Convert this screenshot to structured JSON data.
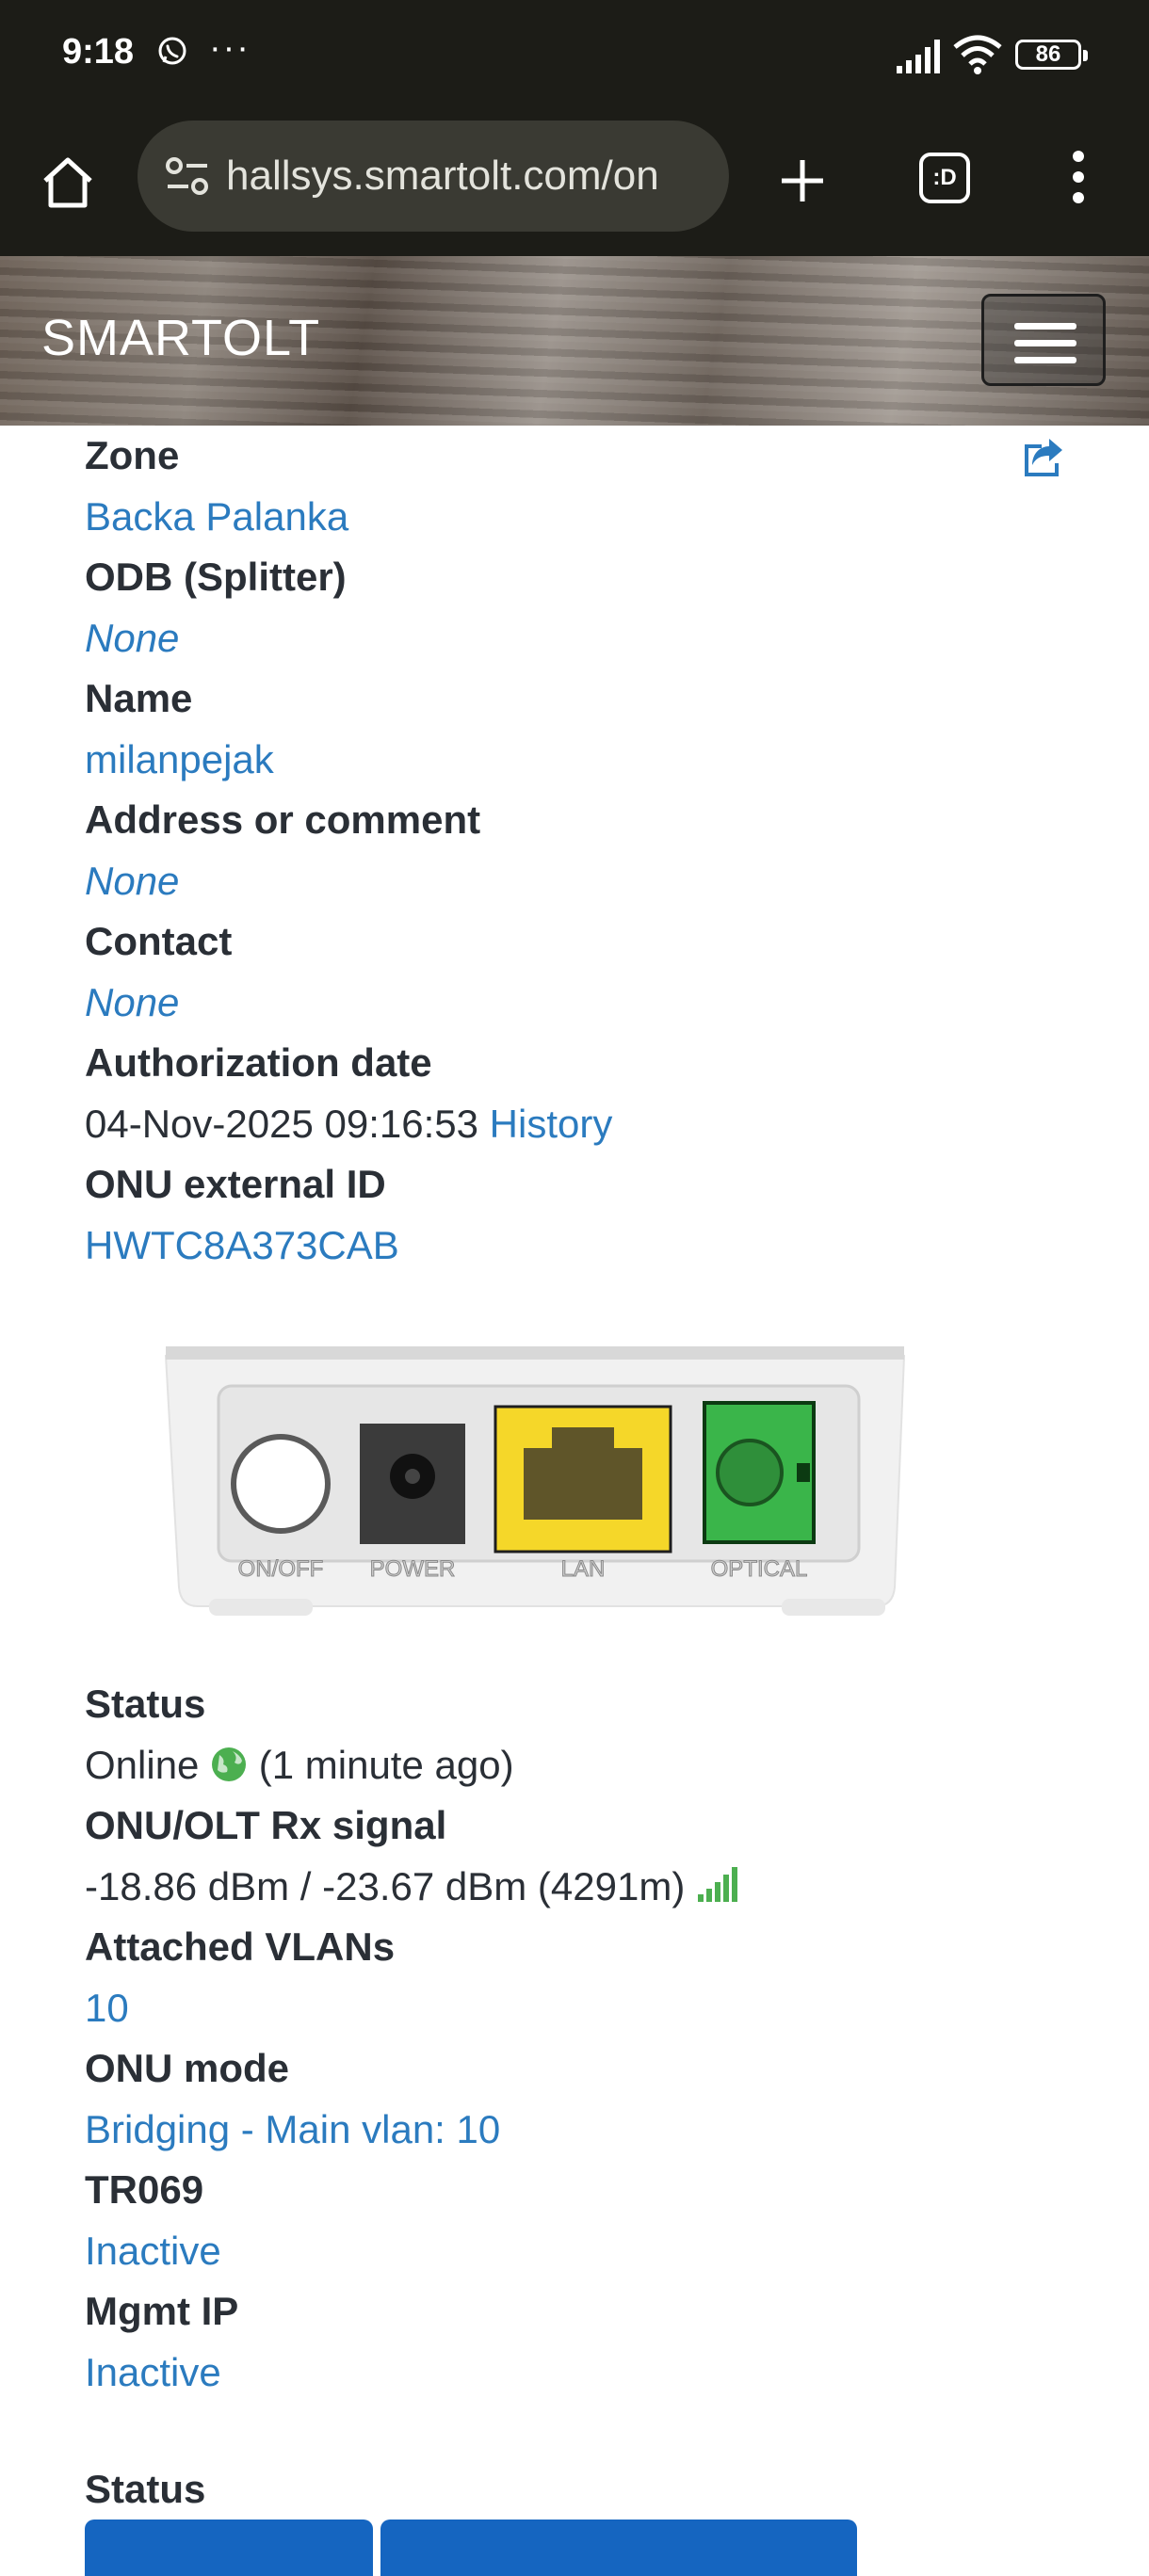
{
  "status_bar": {
    "time": "9:18",
    "more": "···",
    "battery": "86",
    "icons": [
      "viber-icon",
      "signal-icon",
      "wifi-icon",
      "battery-icon"
    ]
  },
  "browser": {
    "url": "hallsys.smartolt.com/on",
    "tab_switcher_label": ":D",
    "icons": [
      "home-icon",
      "site-settings-icon",
      "new-tab-plus-icon",
      "tab-switcher-icon",
      "overflow-menu-icon"
    ]
  },
  "navbar": {
    "brand": "SMARTOLT",
    "menu_icon": "hamburger-icon"
  },
  "details": [
    {
      "label": "Zone",
      "value": "Backa Palanka",
      "style": "link"
    },
    {
      "label": "ODB (Splitter)",
      "value": "None",
      "style": "link-italic"
    },
    {
      "label": "Name",
      "value": "milanpejak",
      "style": "link"
    },
    {
      "label": "Address or comment",
      "value": "None",
      "style": "link-italic"
    },
    {
      "label": "Contact",
      "value": "None",
      "style": "link-italic"
    },
    {
      "label": "Authorization date",
      "value": "04-Nov-2025 09:16:53",
      "link": "History"
    },
    {
      "label": "ONU external ID",
      "value": "HWTC8A373CAB",
      "style": "link"
    }
  ],
  "device_ports": [
    "ON/OFF",
    "POWER",
    "LAN",
    "OPTICAL"
  ],
  "status_details": [
    {
      "label": "Status",
      "value": "Online",
      "suffix": "(1 minute ago)",
      "icon": "globe-icon"
    },
    {
      "label": "ONU/OLT Rx signal",
      "value": "-18.86 dBm / -23.67 dBm (4291m)",
      "icon": "signal-bars-icon"
    },
    {
      "label": "Attached VLANs",
      "value": "10"
    },
    {
      "label": "ONU mode",
      "value": "Bridging - Main vlan: 10"
    },
    {
      "label": "TR069",
      "value": "Inactive"
    },
    {
      "label": "Mgmt IP",
      "value": "Inactive"
    }
  ],
  "section_status_label": "Status",
  "colors": {
    "link": "#2b7bbf",
    "online_green": "#4caf50",
    "button_blue": "#1565c0",
    "toolbar": "#1c1c17"
  }
}
